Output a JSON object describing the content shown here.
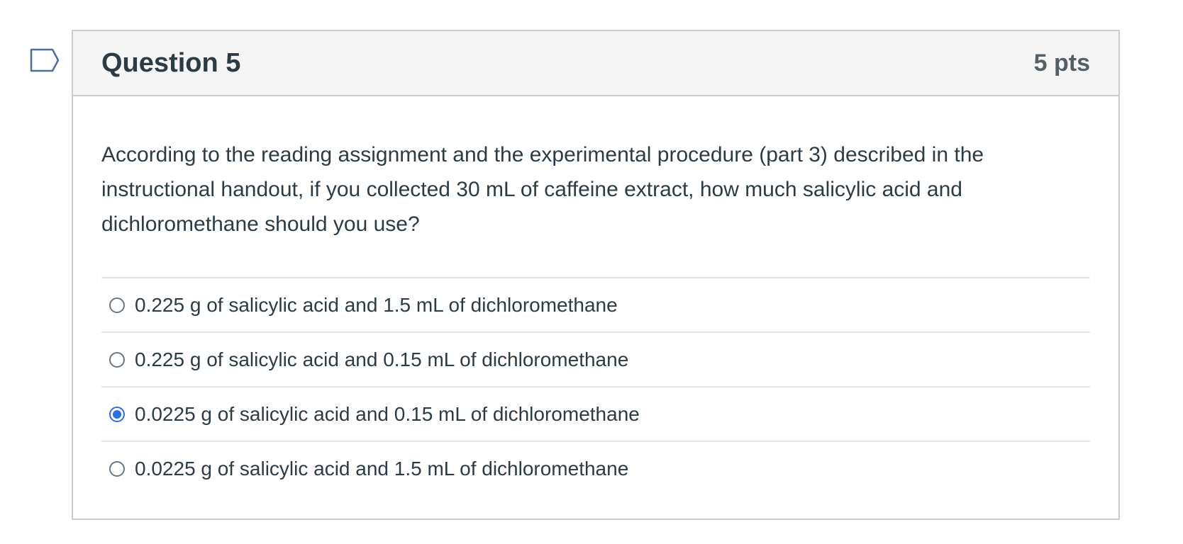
{
  "question": {
    "title": "Question 5",
    "points": "5 pts",
    "text": "According to the reading assignment and the experimental procedure (part 3) described in the instructional handout, if you collected 30 mL of caffeine extract, how much salicylic acid and dichloromethane should you use?",
    "flag_icon": "flag-outline-icon",
    "answers": [
      {
        "label": "0.225 g of salicylic acid and 1.5 mL of dichloromethane",
        "selected": false
      },
      {
        "label": "0.225 g of salicylic acid and 0.15 mL of dichloromethane",
        "selected": false
      },
      {
        "label": "0.0225 g of salicylic acid and 0.15 mL of dichloromethane",
        "selected": true
      },
      {
        "label": "0.0225 g of salicylic acid and 1.5 mL of dichloromethane",
        "selected": false
      }
    ],
    "accent_color": "#2b6fe6"
  }
}
